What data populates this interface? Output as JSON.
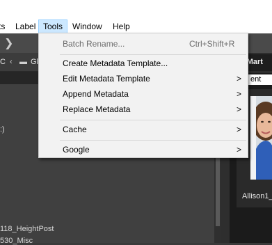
{
  "menubar": {
    "items": [
      {
        "label": "ts"
      },
      {
        "label": "Label"
      },
      {
        "label": "Tools"
      },
      {
        "label": "Window"
      },
      {
        "label": "Help"
      }
    ]
  },
  "pathbar": {
    "left_text": "C",
    "crumb_text": "Gl"
  },
  "left_panel": {
    "fragment_1": ":)",
    "file_1": "118_HeightPost",
    "file_2": "530_Misc"
  },
  "right_panel": {
    "header_text": "nMart",
    "tab_label": "ent",
    "thumbnail_label": "Allison1_"
  },
  "tools_menu": {
    "batch_rename": "Batch Rename...",
    "batch_rename_shortcut": "Ctrl+Shift+R",
    "create_metadata_template": "Create Metadata Template...",
    "edit_metadata_template": "Edit Metadata Template",
    "append_metadata": "Append Metadata",
    "replace_metadata": "Replace Metadata",
    "cache": "Cache",
    "google": "Google",
    "submenu_arrow": ">"
  }
}
